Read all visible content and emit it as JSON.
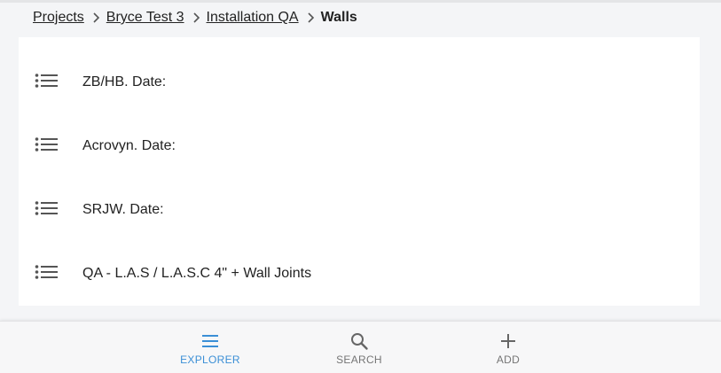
{
  "breadcrumb": {
    "items": [
      "Projects",
      "Bryce Test 3",
      "Installation QA"
    ],
    "current": "Walls"
  },
  "list": {
    "items": [
      {
        "label": "ZB/HB. Date:",
        "icon": "list-icon"
      },
      {
        "label": "Acrovyn. Date:",
        "icon": "list-icon"
      },
      {
        "label": "SRJW. Date:",
        "icon": "list-icon"
      },
      {
        "label": "QA - L.A.S / L.A.S.C 4\" + Wall Joints",
        "icon": "list-icon"
      }
    ]
  },
  "bottom_nav": {
    "items": [
      {
        "label": "EXPLORER",
        "icon": "hamburger-menu-icon",
        "active": true
      },
      {
        "label": "SEARCH",
        "icon": "search-icon",
        "active": false
      },
      {
        "label": "ADD",
        "icon": "plus-icon",
        "active": false
      }
    ]
  },
  "colors": {
    "accent": "#3b8fd6",
    "nav_inactive": "#757575",
    "icon_gray": "#555555",
    "page_bg": "#f4f5f7",
    "panel_bg": "#ffffff"
  }
}
